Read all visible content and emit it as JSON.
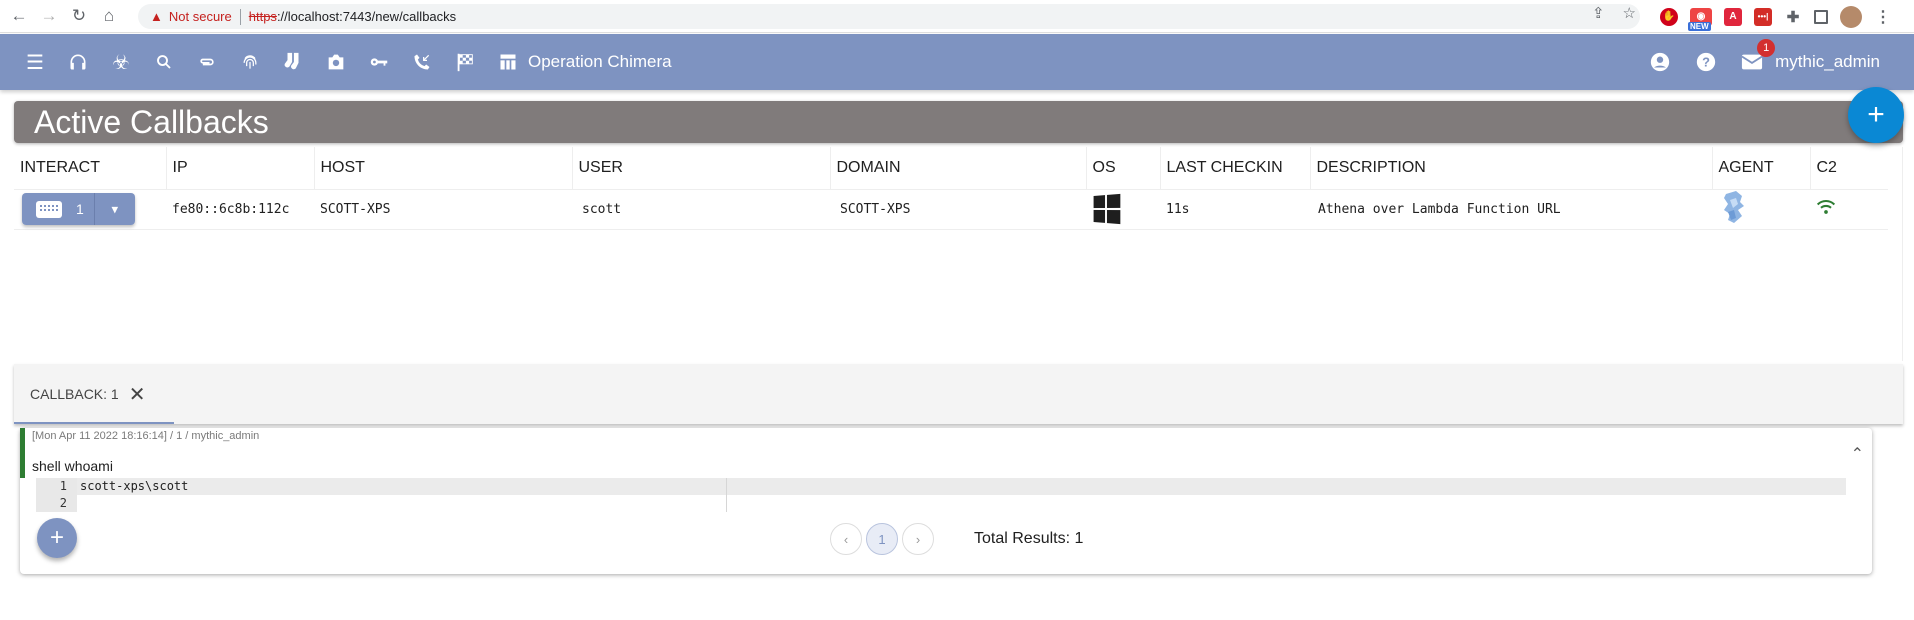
{
  "browser": {
    "back_icon": "arrow-left-icon",
    "forward_icon": "arrow-right-icon",
    "reload_icon": "reload-icon",
    "home_icon": "home-icon",
    "security_warning": "Not secure",
    "url_protocol": "https",
    "url_rest": "://localhost:7443/new/callbacks",
    "extensions": [
      "adblock",
      "new-camera",
      "acrobat",
      "lastpass",
      "extensions-puzzle",
      "side-panel",
      "profile-avatar",
      "menu"
    ],
    "extension_new_badge": "NEW"
  },
  "appbar": {
    "icons": [
      "menu-icon",
      "headphones-icon",
      "biohazard-icon",
      "search-icon",
      "paperclip-icon",
      "fingerprint-icon",
      "socks-icon",
      "camera-icon",
      "key-icon",
      "phone-callback-icon",
      "checkered-flag-icon",
      "table-icon"
    ],
    "operation_name": "Operation Chimera",
    "notification_count": "1",
    "username": "mythic_admin"
  },
  "page": {
    "title": "Active Callbacks",
    "add_button": "+"
  },
  "callbacks_table": {
    "headers": [
      "INTERACT",
      "IP",
      "HOST",
      "USER",
      "DOMAIN",
      "OS",
      "LAST CHECKIN",
      "DESCRIPTION",
      "AGENT",
      "C2"
    ],
    "rows": [
      {
        "id": "1",
        "ip": "fe80::6c8b:112c",
        "host": "SCOTT-XPS",
        "user": "scott",
        "domain": "SCOTT-XPS",
        "os": "windows",
        "last_checkin": "11s",
        "description": "Athena over Lambda Function URL",
        "agent": "athena",
        "c2": "wifi-connected"
      }
    ]
  },
  "tabs": [
    {
      "label": "CALLBACK: 1",
      "active": true
    }
  ],
  "task": {
    "meta": "[Mon Apr 11 2022 18:16:14] / 1 / mythic_admin",
    "command": "shell whoami",
    "output_lines": [
      {
        "number": "1",
        "text": "scott-xps\\scott"
      },
      {
        "number": "2",
        "text": ""
      }
    ]
  },
  "pagination": {
    "prev": "‹",
    "current_page": "1",
    "next": "›",
    "total_label": "Total Results: 1"
  },
  "colors": {
    "appbar": "#7e93c1",
    "title_bar": "#807b7b",
    "fab_primary": "#0a88d4",
    "success": "#2e7d32",
    "badge": "#d32f2f"
  }
}
